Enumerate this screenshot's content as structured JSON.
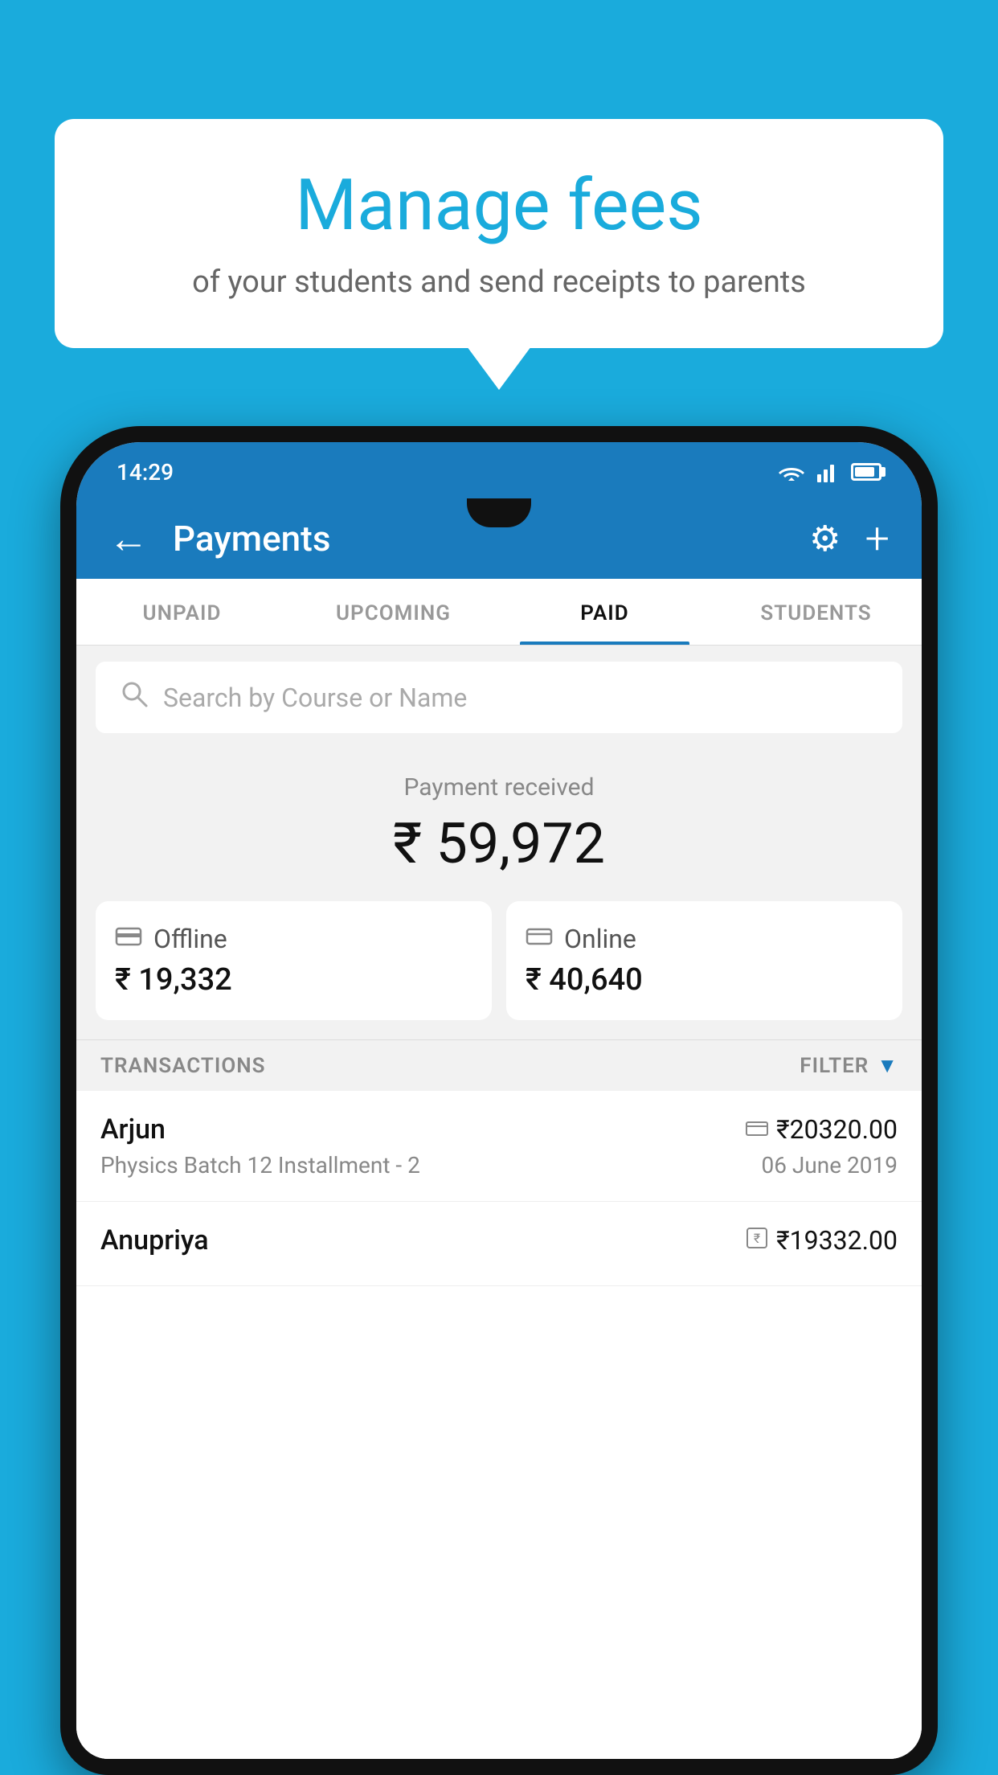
{
  "bubble": {
    "title": "Manage fees",
    "subtitle": "of your students and send receipts to parents"
  },
  "statusBar": {
    "time": "14:29"
  },
  "appBar": {
    "title": "Payments",
    "back_label": "←",
    "gear_label": "⚙",
    "plus_label": "+"
  },
  "tabs": [
    {
      "label": "UNPAID",
      "active": false
    },
    {
      "label": "UPCOMING",
      "active": false
    },
    {
      "label": "PAID",
      "active": true
    },
    {
      "label": "STUDENTS",
      "active": false
    }
  ],
  "search": {
    "placeholder": "Search by Course or Name"
  },
  "paymentSummary": {
    "label": "Payment received",
    "amount": "₹ 59,972"
  },
  "paymentCards": [
    {
      "type": "Offline",
      "amount": "₹ 19,332",
      "icon": "💳"
    },
    {
      "type": "Online",
      "amount": "₹ 40,640",
      "icon": "🏦"
    }
  ],
  "transactionsSection": {
    "label": "TRANSACTIONS",
    "filter_label": "FILTER"
  },
  "transactions": [
    {
      "name": "Arjun",
      "detail": "Physics Batch 12 Installment - 2",
      "amount": "₹20320.00",
      "date": "06 June 2019",
      "icon_type": "card"
    },
    {
      "name": "Anupriya",
      "detail": "",
      "amount": "₹19332.00",
      "date": "",
      "icon_type": "rupee"
    }
  ]
}
